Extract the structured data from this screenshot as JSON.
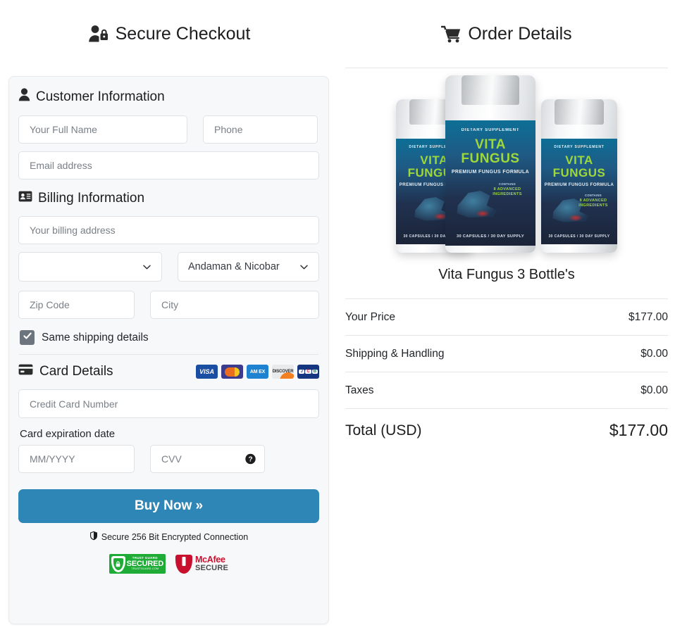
{
  "colors": {
    "accent_button": "#2e86b6",
    "panel_bg": "#f7f8f9",
    "border": "#dfe2e5",
    "checkbox": "#6c757d",
    "text": "#212529",
    "placeholder": "#7a8087",
    "trustguard_green": "#1eab36",
    "mcafee_red": "#c8102e"
  },
  "checkout": {
    "title": "Secure Checkout",
    "title_icon": "user-lock-icon",
    "customer_section": {
      "heading": "Customer Information",
      "icon": "user-icon",
      "fields": {
        "full_name_placeholder": "Your Full Name",
        "full_name_value": "",
        "phone_placeholder": "Phone",
        "phone_value": "",
        "email_placeholder": "Email address",
        "email_value": ""
      }
    },
    "billing_section": {
      "heading": "Billing Information",
      "icon": "id-card-icon",
      "address_placeholder": "Your billing address",
      "address_value": "",
      "country_selected": "",
      "state_selected": "Andaman & Nicobar",
      "zip_placeholder": "Zip Code",
      "zip_value": "",
      "city_placeholder": "City",
      "city_value": "",
      "dropdown_icon": "chevron-down-icon"
    },
    "shipping_checkbox": {
      "label": "Same shipping details",
      "checked": true,
      "check_icon": "check-icon"
    },
    "card_section": {
      "heading": "Card Details",
      "icon": "credit-card-icon",
      "accepted_cards": [
        {
          "name": "visa",
          "label": "VISA"
        },
        {
          "name": "mastercard",
          "label": ""
        },
        {
          "name": "amex",
          "label": "AM EX"
        },
        {
          "name": "discover",
          "label": "DISCOVER"
        },
        {
          "name": "jcb",
          "label": "JCB"
        }
      ],
      "card_number_placeholder": "Credit Card Number",
      "card_number_value": "",
      "expiration_label": "Card expiration date",
      "expiration_placeholder": "MM/YYYY",
      "expiration_value": "",
      "cvv_placeholder": "CVV",
      "cvv_value": "",
      "cvv_help_icon": "question-circle-icon"
    },
    "buy_button": {
      "label": "Buy Now »"
    },
    "secure_note": {
      "icon": "shield-icon",
      "text": "Secure 256 Bit Encrypted Connection"
    },
    "badges": [
      {
        "name": "trust-guard-secured",
        "line1": "TRUST GUARD",
        "line2": "SECURED",
        "line3": "TRUSTGUARD.COM",
        "icon": "lock-shield-icon"
      },
      {
        "name": "mcafee-secure",
        "line1": "McAfee",
        "line2": "SECURE",
        "icon": "mcafee-shield-icon"
      }
    ]
  },
  "order": {
    "title": "Order Details",
    "title_icon": "shopping-cart-icon",
    "product": {
      "image_name": "vita-fungus-3-bottles-image",
      "name": "Vita Fungus 3 Bottle's",
      "label_lines": {
        "supplement": "DIETARY SUPPLEMENT",
        "brand_line1": "VITA",
        "brand_line2": "FUNGUS",
        "formula": "PREMIUM FUNGUS FORMULA",
        "contains": "CONTAINS",
        "ingredients": "8 ADVANCED INGREDIENTS",
        "capsules": "30 CAPSULES / 30 DAY SUPPLY"
      }
    },
    "summary_rows": [
      {
        "label": "Your Price",
        "value": "$177.00"
      },
      {
        "label": "Shipping & Handling",
        "value": "$0.00"
      },
      {
        "label": "Taxes",
        "value": "$0.00"
      }
    ],
    "total": {
      "label": "Total (USD)",
      "value": "$177.00"
    }
  }
}
